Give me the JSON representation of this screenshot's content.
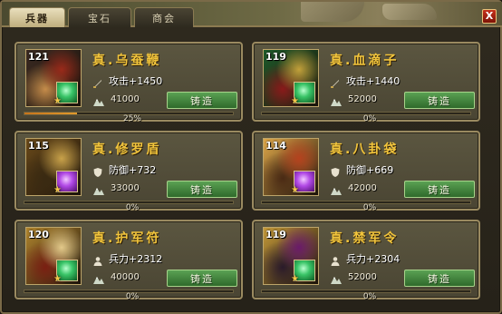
{
  "tabs": [
    {
      "label": "兵器",
      "active": true
    },
    {
      "label": "宝石",
      "active": false
    },
    {
      "label": "商会",
      "active": false
    }
  ],
  "close_label": "X",
  "forge_label": "铸造",
  "items": [
    {
      "level": "121",
      "name": "真.乌蚕鞭",
      "stat_icon": "sword-icon",
      "stat": "攻击+1450",
      "cost": "41000",
      "progress_text": "25%",
      "progress": 0.25,
      "gem_color": "green",
      "art_colors": [
        "#9a2a1a",
        "#3a2a22",
        "#c58c4a"
      ]
    },
    {
      "level": "119",
      "name": "真.血滴子",
      "stat_icon": "sword-icon",
      "stat": "攻击+1440",
      "cost": "52000",
      "progress_text": "0%",
      "progress": 0,
      "gem_color": "green",
      "art_colors": [
        "#c2a03a",
        "#1f5a2a",
        "#8a1a1a"
      ]
    },
    {
      "level": "115",
      "name": "真.修罗盾",
      "stat_icon": "shield-icon",
      "stat": "防御+732",
      "cost": "33000",
      "progress_text": "0%",
      "progress": 0,
      "gem_color": "purple",
      "art_colors": [
        "#c9a24a",
        "#6a4a1a",
        "#3a2a12"
      ]
    },
    {
      "level": "114",
      "name": "真.八卦袋",
      "stat_icon": "shield-icon",
      "stat": "防御+669",
      "cost": "42000",
      "progress_text": "0%",
      "progress": 0,
      "gem_color": "purple",
      "art_colors": [
        "#b5421e",
        "#e0a84a",
        "#4a2a14"
      ]
    },
    {
      "level": "120",
      "name": "真.护军符",
      "stat_icon": "troop-icon",
      "stat": "兵力+2312",
      "cost": "40000",
      "progress_text": "0%",
      "progress": 0,
      "gem_color": "green",
      "art_colors": [
        "#e3c98a",
        "#b1852e",
        "#7a1f12"
      ]
    },
    {
      "level": "119",
      "name": "真.禁军令",
      "stat_icon": "troop-icon",
      "stat": "兵力+2304",
      "cost": "52000",
      "progress_text": "0%",
      "progress": 0,
      "gem_color": "green",
      "art_colors": [
        "#6a1a6a",
        "#c59a3a",
        "#2a1a2a"
      ]
    }
  ]
}
